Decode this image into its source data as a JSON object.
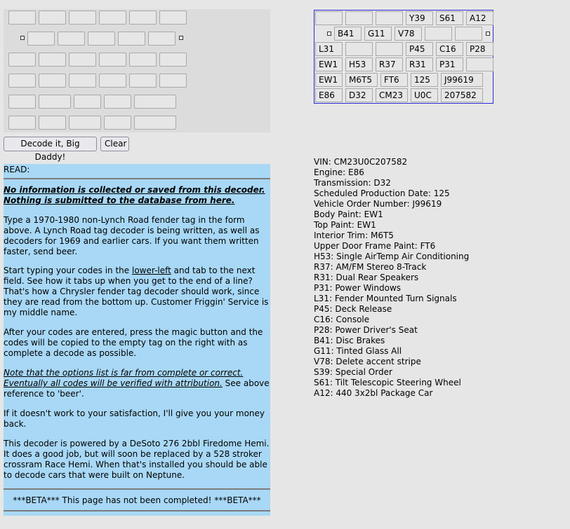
{
  "buttons": {
    "decode": "Decode it, Big Daddy!",
    "clear": "Clear"
  },
  "tag": {
    "rows": [
      [
        "",
        "",
        "",
        "Y39",
        "S61",
        "A12"
      ],
      [
        "B41",
        "G11",
        "V78",
        "",
        ""
      ],
      [
        "L31",
        "",
        "",
        "P45",
        "C16",
        "P28"
      ],
      [
        "EW1",
        "H53",
        "R37",
        "R31",
        "P31",
        ""
      ],
      [
        "EW1",
        "M6T5",
        "FT6",
        "125",
        "J99619"
      ],
      [
        "E86",
        "D32",
        "CM23",
        "U0C",
        "207582"
      ]
    ]
  },
  "read": {
    "heading": "READ:",
    "privacy_1": "No information is collected or saved from this decoder.",
    "privacy_2": "Nothing is submitted to the database from here.",
    "intro": "Type a 1970-1980 non-Lynch Road fender tag in the form above. A Lynch Road tag decoder is being written, as well as decoders for 1969 and earlier cars.  If you want them written faster, send beer.",
    "start_a": "Start typing your codes in the ",
    "start_link": "lower-left",
    "start_b": " and tab to the next field. See how it tabs up when you get to the end of a line? That's how a Chrysler fender tag decoder should work, since they are read from the bottom up. Customer Friggin' Service is my middle name.",
    "after": "After your codes are entered, press the magic button and the codes will be copied to the empty tag on the right with as complete a decode as possible.",
    "note_1": "Note that the options list is far from complete or correct.",
    "note_2": "Eventually all codes will be verified with attribution.",
    "note_3": " See above reference to 'beer'.",
    "money": "If it doesn't work to your satisfaction, I'll give you your money back.",
    "powered": "This decoder is powered by a DeSoto 276 2bbl Firedome Hemi.  It does a good job, but will soon be replaced by a 528 stroker crossram Race Hemi. When that's installed you should be able to decode cars that were built on Neptune.",
    "beta": "***BETA*** This page has not been completed! ***BETA***"
  },
  "results": [
    "VIN: CM23U0C207582",
    "Engine: E86",
    "Transmission: D32",
    "Scheduled Production Date: 125",
    "Vehicle Order Number: J99619",
    "Body Paint: EW1",
    "Top Paint: EW1",
    "Interior Trim: M6T5",
    "Upper Door Frame Paint: FT6",
    "H53: Single AirTemp Air Conditioning",
    "R37: AM/FM Stereo 8-Track",
    "R31: Dual Rear Speakers",
    "P31: Power Windows",
    "L31: Fender Mounted Turn Signals",
    "P45: Deck Release",
    "C16: Console",
    "P28: Power Driver's Seat",
    "B41: Disc Brakes",
    "G11:  Tinted Glass All",
    "V78: Delete accent stripe",
    "S39: Special Order",
    "S61: Tilt Telescopic Steering Wheel",
    "A12: 440 3x2bl Package Car"
  ]
}
